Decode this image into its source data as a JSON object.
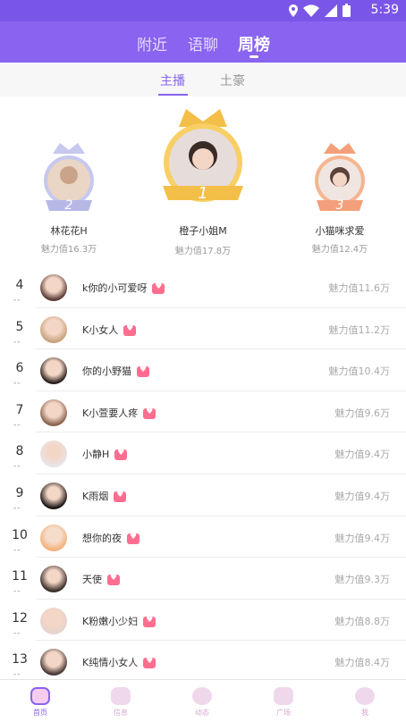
{
  "status_bar": {
    "time": "5:39"
  },
  "top_tabs": [
    {
      "label": "附近",
      "active": false
    },
    {
      "label": "语聊",
      "active": false
    },
    {
      "label": "周榜",
      "active": true
    }
  ],
  "sub_tabs": [
    {
      "label": "主播",
      "active": true
    },
    {
      "label": "土豪",
      "active": false
    }
  ],
  "podium": {
    "first": {
      "rank": "1",
      "name": "橙子小姐M",
      "value": "魅力值17.8万"
    },
    "second": {
      "rank": "2",
      "name": "林花花H",
      "value": "魅力值16.3万"
    },
    "third": {
      "rank": "3",
      "name": "小猫咪求爱",
      "value": "魅力值12.4万"
    }
  },
  "ranking": [
    {
      "rank": "4",
      "change": "--",
      "name": "k你的小可爱呀",
      "value": "魅力值11.6万"
    },
    {
      "rank": "5",
      "change": "--",
      "name": "K小女人",
      "value": "魅力值11.2万"
    },
    {
      "rank": "6",
      "change": "--",
      "name": "你的小野猫",
      "value": "魅力值10.4万"
    },
    {
      "rank": "7",
      "change": "--",
      "name": "K小萱要人疼",
      "value": "魅力值9.6万"
    },
    {
      "rank": "8",
      "change": "--",
      "name": "小静H",
      "value": "魅力值9.4万"
    },
    {
      "rank": "9",
      "change": "--",
      "name": "K雨烟",
      "value": "魅力值9.4万"
    },
    {
      "rank": "10",
      "change": "--",
      "name": "想你的夜",
      "value": "魅力值9.4万"
    },
    {
      "rank": "11",
      "change": "--",
      "name": "天使",
      "value": "魅力值9.3万"
    },
    {
      "rank": "12",
      "change": "--",
      "name": "K粉嫩小少妇",
      "value": "魅力值8.8万"
    },
    {
      "rank": "13",
      "change": "--",
      "name": "K纯情小女人",
      "value": "魅力值8.4万"
    }
  ],
  "bottom_nav": [
    {
      "label": "首页",
      "icon": "home-icon",
      "active": true
    },
    {
      "label": "信息",
      "icon": "message-icon",
      "active": false
    },
    {
      "label": "动态",
      "icon": "moments-icon",
      "active": false
    },
    {
      "label": "广场",
      "icon": "plaza-icon",
      "active": false
    },
    {
      "label": "我",
      "icon": "profile-icon",
      "active": false
    }
  ],
  "colors": {
    "accent": "#8a63f0",
    "gold": "#f3bf48",
    "silver": "#b7b8e6",
    "bronze": "#f3a07a",
    "heart": "#ff6d8f"
  }
}
